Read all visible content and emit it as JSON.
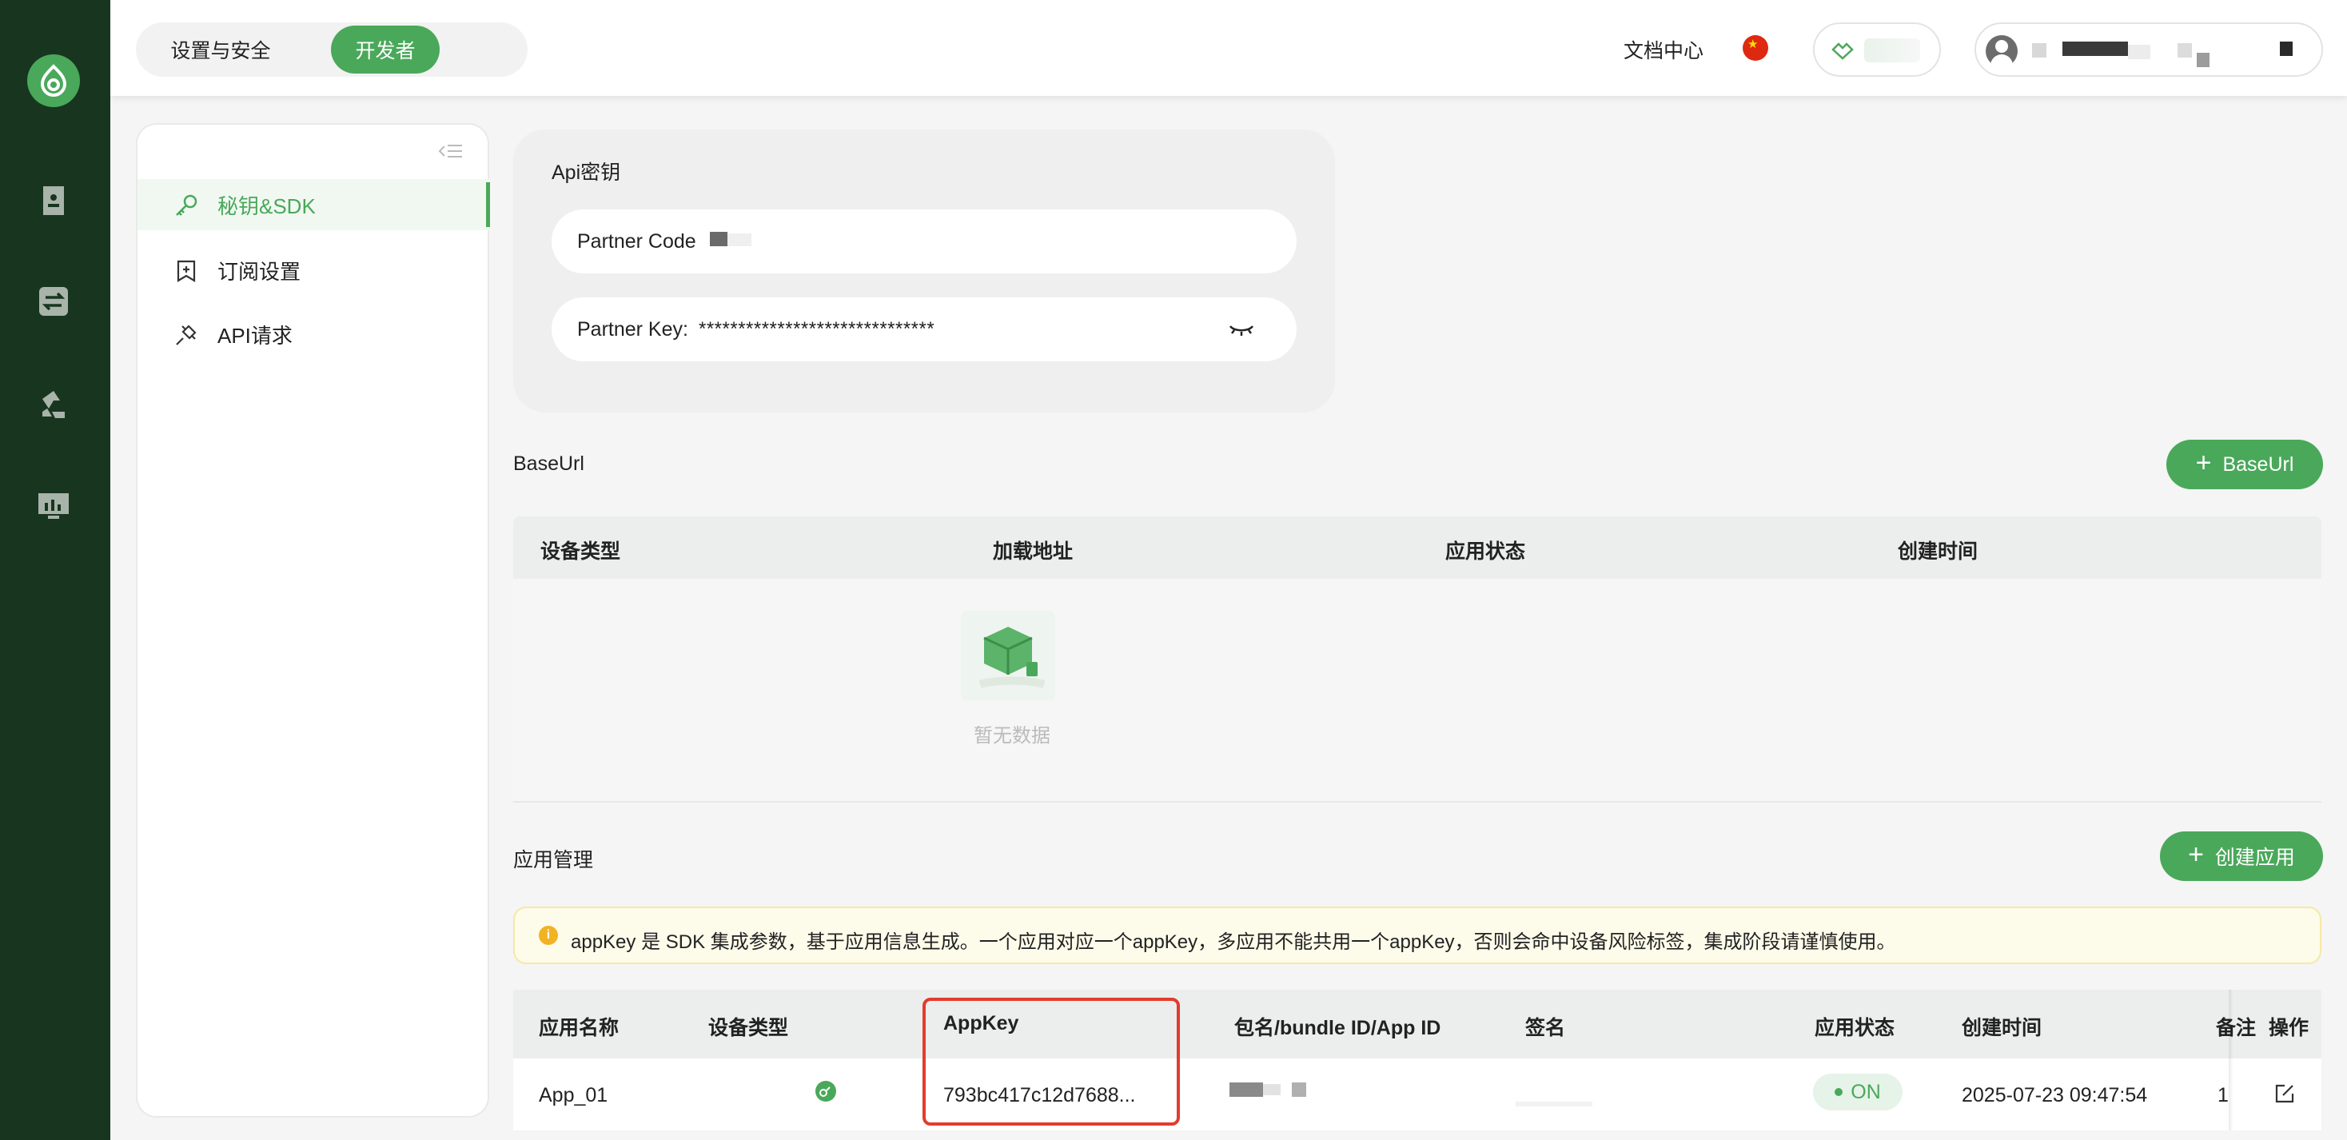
{
  "header": {
    "tabs": [
      {
        "label": "设置与安全",
        "active": false
      },
      {
        "label": "开发者",
        "active": true
      }
    ],
    "doc_center": "文档中心",
    "language": "china-flag-icon"
  },
  "sidebar": {
    "items": [
      {
        "label": "秘钥&SDK",
        "icon": "key-icon",
        "active": true
      },
      {
        "label": "订阅设置",
        "icon": "bookmark-icon",
        "active": false
      },
      {
        "label": "API请求",
        "icon": "plug-icon",
        "active": false
      }
    ]
  },
  "api_keys": {
    "title": "Api密钥",
    "partner_code_label": "Partner Code",
    "partner_key_label": "Partner Key:",
    "partner_key_value": "******************************"
  },
  "baseurl": {
    "title": "BaseUrl",
    "add_button": "BaseUrl",
    "columns": [
      "设备类型",
      "加载地址",
      "应用状态",
      "创建时间"
    ],
    "empty_text": "暂无数据"
  },
  "apps": {
    "title": "应用管理",
    "create_button": "创建应用",
    "notice": "appKey 是 SDK 集成参数，基于应用信息生成。一个应用对应一个appKey，多应用不能共用一个appKey，否则会命中设备风险标签，集成阶段请谨慎使用。",
    "columns": [
      "应用名称",
      "设备类型",
      "AppKey",
      "包名/bundle ID/App ID",
      "签名",
      "应用状态",
      "创建时间",
      "备注",
      "操作"
    ],
    "rows": [
      {
        "name": "App_01",
        "device_icon": "device-icon",
        "appkey": "793bc417c12d7688...",
        "status": "ON",
        "created": "2025-07-23 09:47:54",
        "remark": "1"
      }
    ]
  },
  "colors": {
    "brand_green": "#4aa85a",
    "rail_dark": "#18361f",
    "highlight_red": "#e23c2d"
  }
}
